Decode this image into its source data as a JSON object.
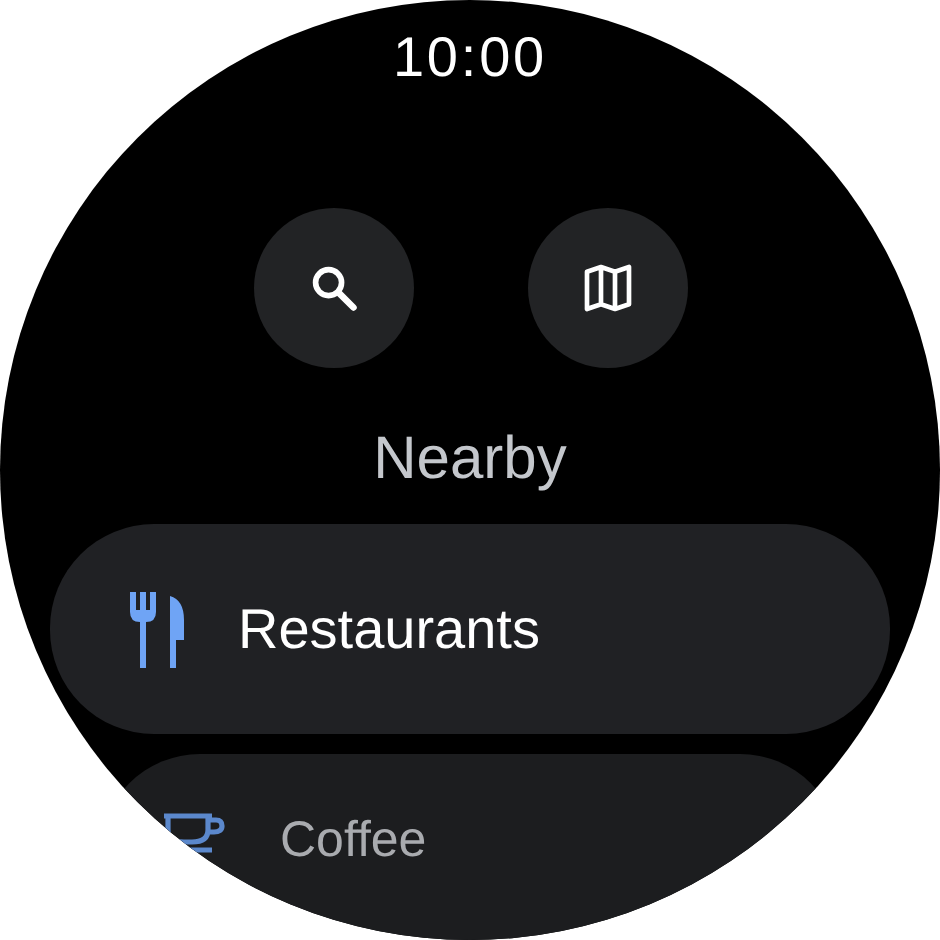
{
  "status_bar": {
    "time": "10:00"
  },
  "actions": [
    {
      "kind": "search"
    },
    {
      "kind": "map"
    }
  ],
  "title": "Nearby",
  "items": [
    {
      "label": "Restaurants"
    },
    {
      "label": "Coffee"
    }
  ]
}
